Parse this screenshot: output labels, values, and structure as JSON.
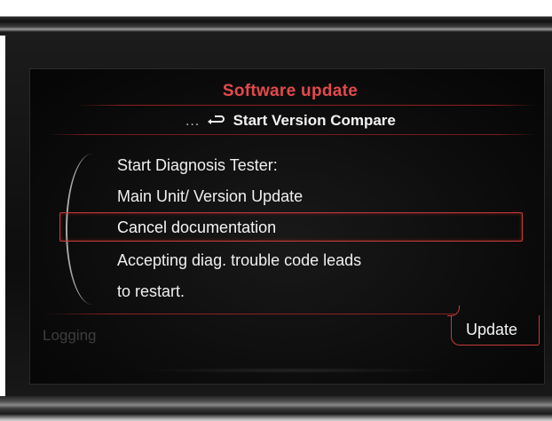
{
  "header": {
    "title": "Software update",
    "breadcrumb_dots": "…",
    "back_icon": "back-arrow-icon",
    "subtitle": "Start Version Compare"
  },
  "menu": {
    "items": [
      "Start Diagnosis Tester:",
      "Main Unit/ Version Update",
      "Cancel documentation",
      "Accepting diag. trouble code leads",
      "to restart."
    ],
    "selected_index": 2
  },
  "footer": {
    "left_label": "Logging",
    "right_tab": "Update"
  },
  "colors": {
    "accent": "#e34a4a",
    "text": "#f0f0f0",
    "background": "#0a0a0a",
    "disabled": "#3d3d3d"
  }
}
